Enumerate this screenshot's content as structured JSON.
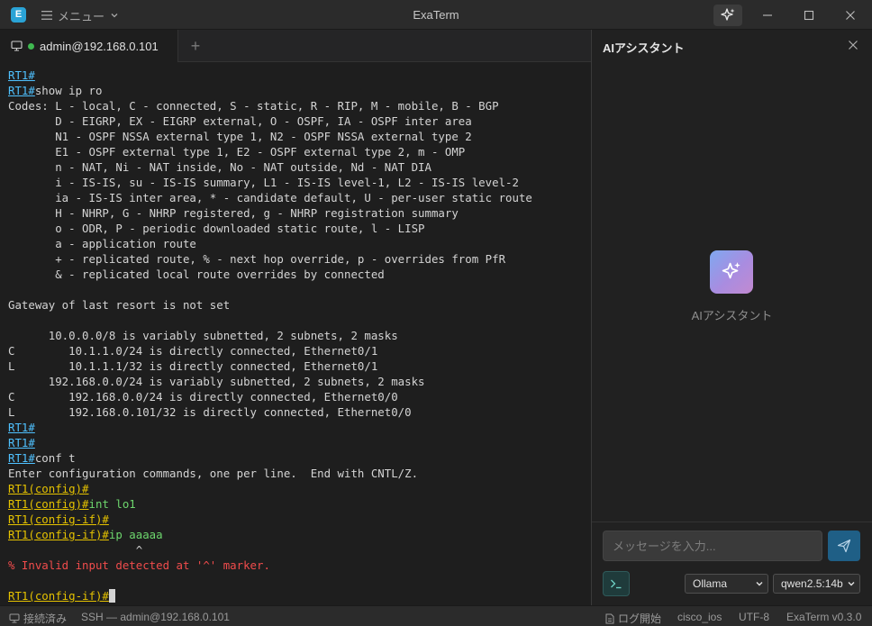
{
  "window": {
    "app_title": "ExaTerm",
    "app_icon_letter": "E"
  },
  "menu": {
    "label": "メニュー"
  },
  "tab": {
    "label": "admin@192.168.0.101",
    "add_label": "+"
  },
  "terminal": {
    "lines": [
      [
        {
          "t": "RT1#",
          "c": "p-blue"
        }
      ],
      [
        {
          "t": "RT1#",
          "c": "p-blue"
        },
        {
          "t": "show ip ro",
          "c": ""
        }
      ],
      [
        {
          "t": "Codes: L - local, C - connected, S - static, R - RIP, M - mobile, B - BGP",
          "c": ""
        }
      ],
      [
        {
          "t": "       D - EIGRP, EX - EIGRP external, O - OSPF, IA - OSPF inter area",
          "c": ""
        }
      ],
      [
        {
          "t": "       N1 - OSPF NSSA external type 1, N2 - OSPF NSSA external type 2",
          "c": ""
        }
      ],
      [
        {
          "t": "       E1 - OSPF external type 1, E2 - OSPF external type 2, m - OMP",
          "c": ""
        }
      ],
      [
        {
          "t": "       n - NAT, Ni - NAT inside, No - NAT outside, Nd - NAT DIA",
          "c": ""
        }
      ],
      [
        {
          "t": "       i - IS-IS, su - IS-IS summary, L1 - IS-IS level-1, L2 - IS-IS level-2",
          "c": ""
        }
      ],
      [
        {
          "t": "       ia - IS-IS inter area, * - candidate default, U - per-user static route",
          "c": ""
        }
      ],
      [
        {
          "t": "       H - NHRP, G - NHRP registered, g - NHRP registration summary",
          "c": ""
        }
      ],
      [
        {
          "t": "       o - ODR, P - periodic downloaded static route, l - LISP",
          "c": ""
        }
      ],
      [
        {
          "t": "       a - application route",
          "c": ""
        }
      ],
      [
        {
          "t": "       + - replicated route, % - next hop override, p - overrides from PfR",
          "c": ""
        }
      ],
      [
        {
          "t": "       & - replicated local route overrides by connected",
          "c": ""
        }
      ],
      [
        {
          "t": "",
          "c": ""
        }
      ],
      [
        {
          "t": "Gateway of last resort is not set",
          "c": ""
        }
      ],
      [
        {
          "t": "",
          "c": ""
        }
      ],
      [
        {
          "t": "      10.0.0.0/8 is variably subnetted, 2 subnets, 2 masks",
          "c": ""
        }
      ],
      [
        {
          "t": "C        10.1.1.0/24 is directly connected, Ethernet0/1",
          "c": ""
        }
      ],
      [
        {
          "t": "L        10.1.1.1/32 is directly connected, Ethernet0/1",
          "c": ""
        }
      ],
      [
        {
          "t": "      192.168.0.0/24 is variably subnetted, 2 subnets, 2 masks",
          "c": ""
        }
      ],
      [
        {
          "t": "C        192.168.0.0/24 is directly connected, Ethernet0/0",
          "c": ""
        }
      ],
      [
        {
          "t": "L        192.168.0.101/32 is directly connected, Ethernet0/0",
          "c": ""
        }
      ],
      [
        {
          "t": "RT1#",
          "c": "p-blue"
        }
      ],
      [
        {
          "t": "RT1#",
          "c": "p-blue"
        }
      ],
      [
        {
          "t": "RT1#",
          "c": "p-blue"
        },
        {
          "t": "conf t",
          "c": ""
        }
      ],
      [
        {
          "t": "Enter configuration commands, one per line.  End with CNTL/Z.",
          "c": ""
        }
      ],
      [
        {
          "t": "RT1(config)#",
          "c": "p-yellow"
        }
      ],
      [
        {
          "t": "RT1(config)#",
          "c": "p-yellow"
        },
        {
          "t": "int lo1",
          "c": "c-green"
        }
      ],
      [
        {
          "t": "RT1(config-if)#",
          "c": "p-yellow"
        }
      ],
      [
        {
          "t": "RT1(config-if)#",
          "c": "p-yellow"
        },
        {
          "t": "ip aaaaa",
          "c": "c-green"
        }
      ],
      [
        {
          "t": "                   ^",
          "c": ""
        }
      ],
      [
        {
          "t": "% Invalid input detected at '^' marker.",
          "c": "c-red"
        }
      ],
      [
        {
          "t": "",
          "c": ""
        }
      ],
      [
        {
          "t": "RT1(config-if)#",
          "c": "p-yellow"
        }
      ]
    ]
  },
  "ai_panel": {
    "title": "AIアシスタント",
    "empty_label": "AIアシスタント",
    "input_placeholder": "メッセージを入力...",
    "provider": "Ollama",
    "model": "qwen2.5:14b"
  },
  "statusbar": {
    "connection": "接続済み",
    "session": "SSH — admin@192.168.0.101",
    "log": "ログ開始",
    "os": "cisco_ios",
    "encoding": "UTF-8",
    "version": "ExaTerm v0.3.0"
  },
  "colors": {
    "prompt_exec": "#4fc1ff",
    "prompt_config": "#e5c200",
    "command_config": "#6dd66d",
    "error": "#f14c4c",
    "connected_dot": "#3fb950",
    "send_button": "#1f5f86"
  },
  "icons": [
    "app-icon",
    "hamburger-icon",
    "chevron-down-icon",
    "sparkle-icon",
    "minimize-icon",
    "maximize-icon",
    "close-icon",
    "monitor-icon",
    "terminal-icon",
    "send-icon",
    "document-icon"
  ]
}
